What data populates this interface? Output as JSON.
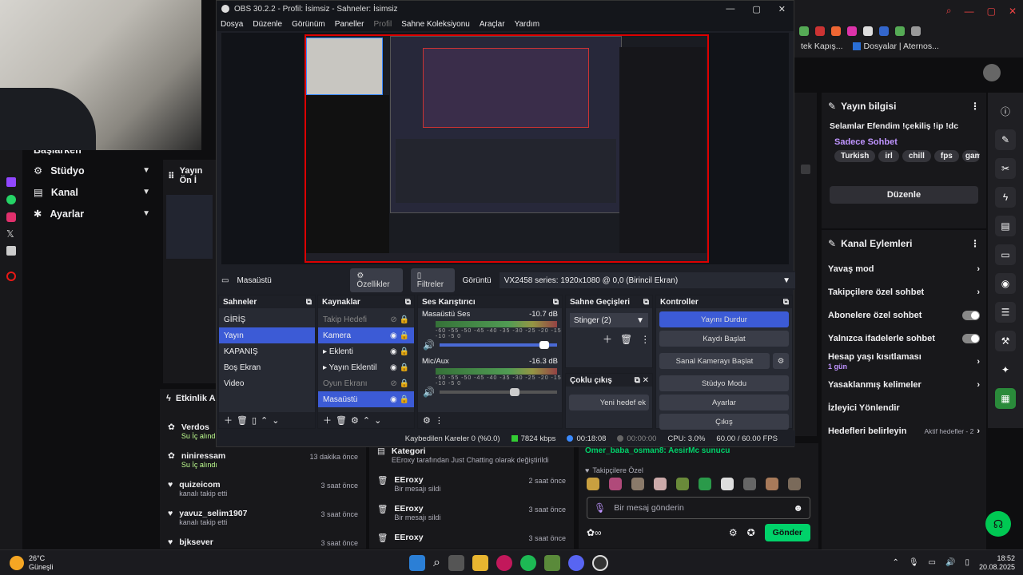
{
  "obs": {
    "title": "OBS 30.2.2 - Profil: İsimsiz - Sahneler: İsimsiz",
    "menu": [
      "Dosya",
      "Düzenle",
      "Görünüm",
      "Paneller",
      "Profil",
      "Sahne Koleksiyonu",
      "Araçlar",
      "Yardım"
    ],
    "source_name": "Masaüstü",
    "properties": "Özellikler",
    "filters": "Filtreler",
    "display_label": "Görüntü",
    "display_value": "VX2458 series: 1920x1080 @ 0,0 (Birincil Ekran)",
    "scenes": {
      "title": "Sahneler",
      "items": [
        "GİRİŞ",
        "Yayın",
        "KAPANIŞ",
        "Boş Ekran",
        "Video"
      ],
      "selected": 1
    },
    "sources": {
      "title": "Kaynaklar",
      "items": [
        "Takip Hedefi",
        "Kamera",
        "Eklenti",
        "Yayın Eklentil",
        "Oyun Ekranı",
        "Masaüstü"
      ]
    },
    "mixer": {
      "title": "Ses Karıştırıcı",
      "ch1_name": "Masaüstü Ses",
      "ch1_db": "-10.7 dB",
      "ch2_name": "Mic/Aux",
      "ch2_db": "-16.3 dB",
      "scale": "-60 -55 -50 -45 -40 -35 -30 -25 -20 -15 -10 -5 0"
    },
    "transitions": {
      "title": "Sahne Geçişleri",
      "value": "Stinger (2)",
      "multi_title": "Çoklu çıkış",
      "multi_btn": "Yeni hedef ek"
    },
    "controls": {
      "title": "Kontroller",
      "buttons": [
        "Yayını Durdur",
        "Kaydı Başlat",
        "Sanal Kamerayı Başlat",
        "Stüdyo Modu",
        "Ayarlar",
        "Çıkış"
      ]
    },
    "status": {
      "dropped": "Kaybedilen Kareler 0 (%0.0)",
      "kbps": "7824 kbps",
      "live": "00:18:08",
      "rec": "00:00:00",
      "cpu": "CPU: 3.0%",
      "fps": "60.00 / 60.00 FPS"
    }
  },
  "twitch": {
    "nav": [
      "Başlarken",
      "Stüdyo",
      "Kanal",
      "Ayarlar"
    ],
    "stream_preview": "Yayın Ön İ",
    "stream_info": {
      "title": "Yayın bilgisi",
      "desc": "Selamlar Efendim !çekiliş !ip !dc",
      "mode": "Sadece Sohbet",
      "tags": [
        "Turkish",
        "irl",
        "chill",
        "fps",
        "gamir"
      ],
      "edit": "Düzenle"
    },
    "channel_actions": {
      "title": "Kanal Eylemleri",
      "items": [
        "Yavaş mod",
        "Takipçilere özel sohbet",
        "Abonelere özel sohbet",
        "Yalnızca ifadelerle sohbet",
        "Hesap yaşı kısıtlaması",
        "Yasaklanmış kelimeler",
        "İzleyici Yönlendir",
        "Hedefleri belirleyin"
      ],
      "age_sub": "1 gün",
      "goals_sub": "Aktif hedefler - 2"
    },
    "activity": {
      "title": "Etkinlik Ak",
      "items": [
        {
          "user": "Verdos",
          "action": "Su İç alındı",
          "time": ""
        },
        {
          "user": "niniressam",
          "action": "Su İç alındı",
          "time": "13 dakika önce"
        },
        {
          "user": "quizeicom",
          "action": "kanalı takip etti",
          "time": "3 saat önce"
        },
        {
          "user": "yavuz_selim1907",
          "action": "kanalı takip etti",
          "time": "3 saat önce"
        },
        {
          "user": "bjksever",
          "action": "",
          "time": "3 saat önce"
        }
      ]
    },
    "mod": [
      {
        "title": "Kategori",
        "desc": "EEroxy tarafından Just Chatting olarak değiştirildi",
        "time": ""
      },
      {
        "title": "EEroxy",
        "desc": "Bir mesajı sildi",
        "time": "2 saat önce"
      },
      {
        "title": "EEroxy",
        "desc": "Bir mesajı sildi",
        "time": "3 saat önce"
      },
      {
        "title": "EEroxy",
        "desc": "",
        "time": "3 saat önce"
      }
    ],
    "chat": {
      "last": "Omer_baba_osman8: AesirMc sunucu",
      "followers_label": "Takipçilere Özel",
      "placeholder": "Bir mesaj gönderin",
      "send": "Gönder"
    }
  },
  "browser": {
    "bookmark1": "tek Kapış...",
    "bookmark2": "Dosyalar | Aternos..."
  },
  "taskbar": {
    "weather_temp": "26°C",
    "weather_desc": "Güneşli",
    "time": "18:52",
    "date": "20.08.2025"
  }
}
